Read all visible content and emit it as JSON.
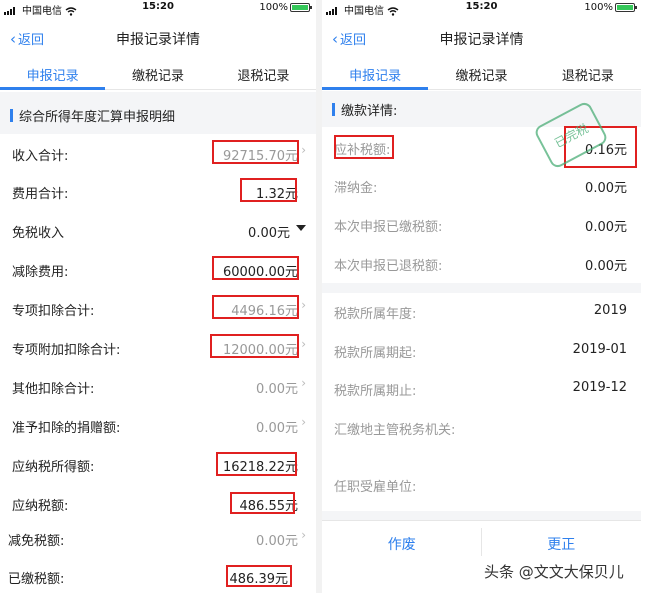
{
  "status": {
    "carrier": "中国电信",
    "time": "15:20",
    "battery": "100%"
  },
  "nav": {
    "back_label": "返回",
    "title": "申报记录详情"
  },
  "tabs": [
    "申报记录",
    "缴税记录",
    "退税记录"
  ],
  "left": {
    "section_title": "综合所得年度汇算申报明细",
    "rows": [
      {
        "label": "收入合计:",
        "value": "92715.70元"
      },
      {
        "label": "费用合计:",
        "value": "1.32元"
      },
      {
        "label": "免税收入",
        "value": "0.00元"
      },
      {
        "label": "减除费用:",
        "value": "60000.00元"
      },
      {
        "label": "专项扣除合计:",
        "value": "4496.16元"
      },
      {
        "label": "专项附加扣除合计:",
        "value": "12000.00元"
      },
      {
        "label": "其他扣除合计:",
        "value": "0.00元"
      },
      {
        "label": "准予扣除的捐赠额:",
        "value": "0.00元"
      },
      {
        "label": "应纳税所得额:",
        "value": "16218.22元"
      },
      {
        "label": "应纳税额:",
        "value": "486.55元"
      },
      {
        "label": "减免税额:",
        "value": "0.00元"
      },
      {
        "label": "已缴税额:",
        "value": "486.39元"
      }
    ]
  },
  "right": {
    "section_title": "缴款详情:",
    "rows": [
      {
        "label": "应补税额:",
        "value": "0.16元"
      },
      {
        "label": "滞纳金:",
        "value": "0.00元"
      },
      {
        "label": "本次申报已缴税额:",
        "value": "0.00元"
      },
      {
        "label": "本次申报已退税额:",
        "value": "0.00元"
      }
    ],
    "rows2": [
      {
        "label": "税款所属年度:",
        "value": "2019"
      },
      {
        "label": "税款所属期起:",
        "value": "2019-01"
      },
      {
        "label": "税款所属期止:",
        "value": "2019-12"
      },
      {
        "label": "汇缴地主管税务机关:",
        "value": ""
      },
      {
        "label": "任职受雇单位:",
        "value": ""
      }
    ],
    "stamp": "已完税",
    "buttons": [
      "作废",
      "更正"
    ]
  },
  "watermark": "头条 @文文大保贝儿",
  "colors": {
    "accent": "#2f80ed",
    "highlight": "#e02020",
    "stamp": "#4cae77"
  }
}
